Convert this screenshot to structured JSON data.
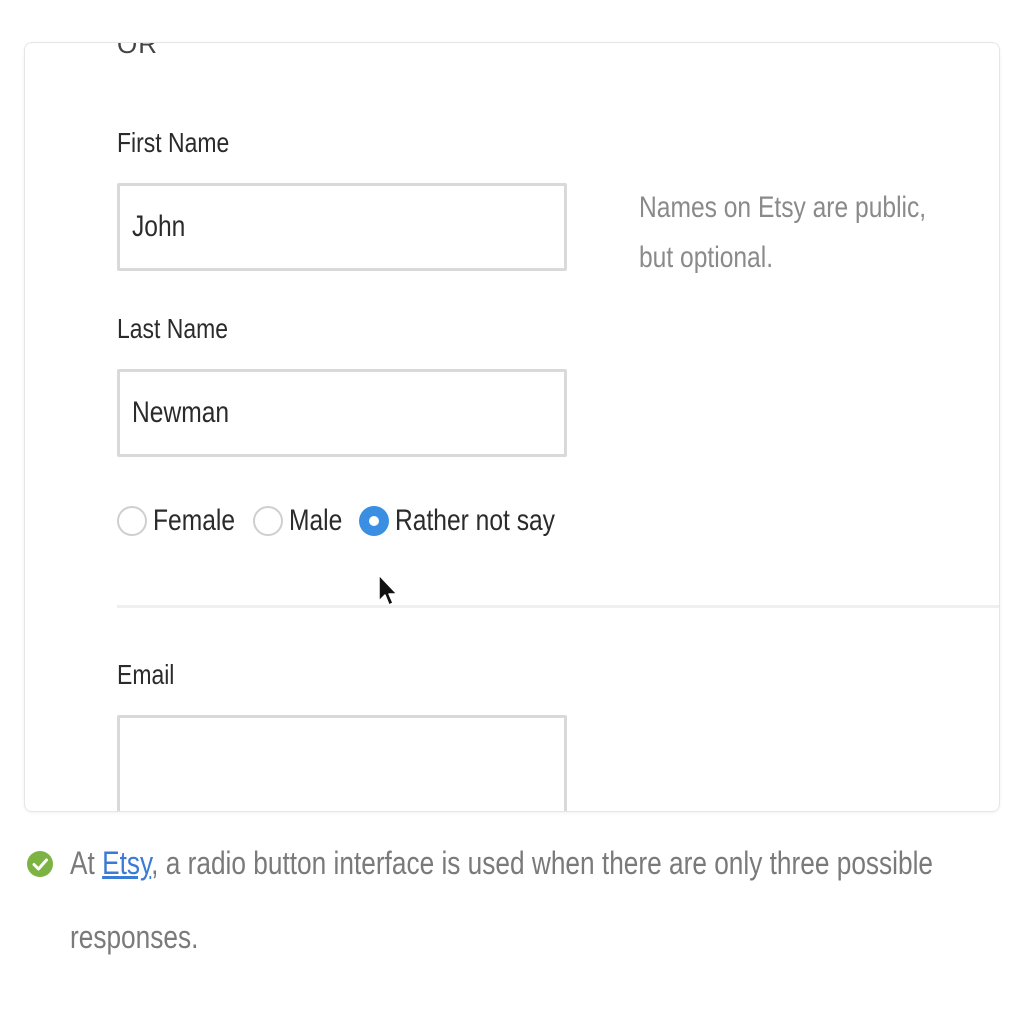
{
  "form": {
    "cut_off_text": "OR",
    "first_name": {
      "label": "First Name",
      "value": "John"
    },
    "last_name": {
      "label": "Last Name",
      "value": "Newman"
    },
    "name_helper_text": "Names on Etsy are public, but optional.",
    "gender": {
      "options": [
        {
          "label": "Female",
          "checked": false
        },
        {
          "label": "Male",
          "checked": false
        },
        {
          "label": "Rather not say",
          "checked": true
        }
      ],
      "selected": "Rather not say"
    },
    "email": {
      "label": "Email",
      "value": ""
    }
  },
  "note": {
    "prefix": "At ",
    "link_text": "Etsy",
    "suffix": ", a radio button interface is used when there are only three possible responses."
  },
  "colors": {
    "accent": "#3a8fe3",
    "check_icon": "#7cb342",
    "link": "#3a7bd5"
  }
}
